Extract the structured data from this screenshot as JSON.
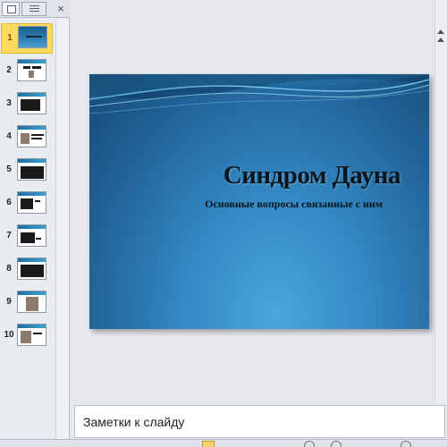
{
  "panel": {
    "close_glyph": "×",
    "tabs": [
      {
        "name": "tab-slides",
        "icon": "slides-icon"
      },
      {
        "name": "tab-outline",
        "icon": "outline-icon"
      }
    ],
    "slides": [
      {
        "number": "1",
        "selected": true,
        "style": "title"
      },
      {
        "number": "2",
        "selected": false,
        "style": "white"
      },
      {
        "number": "3",
        "selected": false,
        "style": "white"
      },
      {
        "number": "4",
        "selected": false,
        "style": "white"
      },
      {
        "number": "5",
        "selected": false,
        "style": "white"
      },
      {
        "number": "6",
        "selected": false,
        "style": "white"
      },
      {
        "number": "7",
        "selected": false,
        "style": "white"
      },
      {
        "number": "8",
        "selected": false,
        "style": "white"
      },
      {
        "number": "9",
        "selected": false,
        "style": "white"
      },
      {
        "number": "10",
        "selected": false,
        "style": "white"
      }
    ]
  },
  "slide": {
    "title": "Синдром Дауна",
    "subtitle": "Основные вопросы связанные с ним"
  },
  "notes": {
    "placeholder": "Заметки к слайду"
  },
  "colors": {
    "selected_highlight": "#fcd95f",
    "slide_blue_dark": "#174a76",
    "slide_blue_light": "#4aa6dc",
    "title_text": "#0b1620"
  }
}
